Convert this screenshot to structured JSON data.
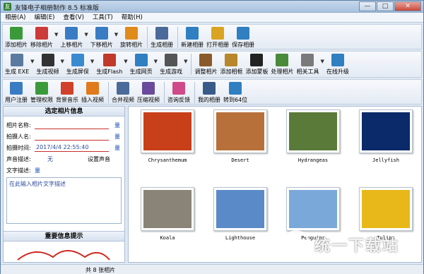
{
  "window": {
    "title": "友锋电子相册制作 8.5 标准版",
    "buttons": {
      "minimize": "—",
      "maximize": "□",
      "close": "✕"
    }
  },
  "menubar": [
    "相册(A)",
    "编辑(E)",
    "查看(V)",
    "工具(T)",
    "帮助(H)"
  ],
  "toolbar1": [
    {
      "label": "添加相片",
      "icon": "add-photo-icon",
      "color": "#3a9a3a"
    },
    {
      "label": "移除相片",
      "icon": "remove-photo-icon",
      "color": "#cc3a3a"
    },
    {
      "label": "上移相片",
      "icon": "move-up-icon",
      "color": "#3a7cc4"
    },
    {
      "label": "下移相片",
      "icon": "move-down-icon",
      "color": "#3a7cc4"
    },
    {
      "label": "旋转相片",
      "icon": "rotate-icon",
      "color": "#e08a1a"
    },
    {
      "label": "生成相册",
      "icon": "build-album-icon",
      "color": "#4a6a9a"
    },
    {
      "label": "新建相册",
      "icon": "new-album-icon",
      "color": "#2f7fc1"
    },
    {
      "label": "打开相册",
      "icon": "open-album-icon",
      "color": "#d9a421"
    },
    {
      "label": "保存相册",
      "icon": "save-album-icon",
      "color": "#2f7fc1"
    }
  ],
  "toolbar2": [
    {
      "label": "生成 EXE",
      "icon": "exe-icon",
      "color": "#5a7aa0"
    },
    {
      "label": "生成视频",
      "icon": "video-icon",
      "color": "#333333"
    },
    {
      "label": "生成屏保",
      "icon": "screensaver-icon",
      "color": "#3a8ad0"
    },
    {
      "label": "生成Flash",
      "icon": "flash-icon",
      "color": "#c0392b"
    },
    {
      "label": "生成网页",
      "icon": "webpage-icon",
      "color": "#2f7fc1"
    },
    {
      "label": "生成游戏",
      "icon": "game-icon",
      "color": "#555555"
    },
    {
      "label": "调整相片",
      "icon": "adjust-photo-icon",
      "color": "#8a5a2a"
    },
    {
      "label": "添加相框",
      "icon": "add-frame-icon",
      "color": "#b8862b"
    },
    {
      "label": "添加蒙板",
      "icon": "add-mask-icon",
      "color": "#222222"
    },
    {
      "label": "处理相片",
      "icon": "process-photo-icon",
      "color": "#4a8a3a"
    },
    {
      "label": "相关工具",
      "icon": "tools-icon",
      "color": "#7a7a7a"
    },
    {
      "label": "在线升级",
      "icon": "upgrade-icon",
      "color": "#2f7fc1"
    }
  ],
  "toolbar3": [
    {
      "label": "用户注册",
      "icon": "register-icon",
      "color": "#3a7cc4"
    },
    {
      "label": "管理权限",
      "icon": "permission-icon",
      "color": "#3a9a3a"
    },
    {
      "label": "背景音乐",
      "icon": "music-icon",
      "color": "#d0402a"
    },
    {
      "label": "插入视频",
      "icon": "insert-video-icon",
      "color": "#e07a1a"
    },
    {
      "label": "合并视频",
      "icon": "merge-video-icon",
      "color": "#4a6a9a"
    },
    {
      "label": "压缩视频",
      "icon": "compress-video-icon",
      "color": "#6a4a9a"
    },
    {
      "label": "咨询反馈",
      "icon": "feedback-icon",
      "color": "#d04a8a"
    },
    {
      "label": "我的相册",
      "icon": "my-album-icon",
      "color": "#3a5a8a"
    },
    {
      "label": "转到64位",
      "icon": "switch-64-icon",
      "color": "#2f7fc1"
    }
  ],
  "photo_info": {
    "header": "选定相片信息",
    "name_label": "相片名称:",
    "photographer_label": "拍摄人名:",
    "time_label": "拍摄时间:",
    "time_value": "2017/4/4 22:55:40",
    "sound_label": "声音描述:",
    "sound_value": "无",
    "set_sound": "设置声音",
    "text_label": "文字描述:",
    "edit_glyph": "量",
    "text_placeholder": "在此输入相片文字描述"
  },
  "hint": {
    "header": "重要信息提示"
  },
  "status": {
    "count_text": "共 8 张相片"
  },
  "photos": [
    {
      "caption": "Chrysanthemum",
      "bg": "#c8401a"
    },
    {
      "caption": "Desert",
      "bg": "#b8703a"
    },
    {
      "caption": "Hydrangeas",
      "bg": "#5a7a3a"
    },
    {
      "caption": "Jellyfish",
      "bg": "#0a2a6a"
    },
    {
      "caption": "Koala",
      "bg": "#8a8478"
    },
    {
      "caption": "Lighthouse",
      "bg": "#5a8ac8"
    },
    {
      "caption": "Penguins",
      "bg": "#7aa8d8"
    },
    {
      "caption": "Tulips",
      "bg": "#e8b81a"
    }
  ],
  "watermark": {
    "text": "统一下载站"
  }
}
